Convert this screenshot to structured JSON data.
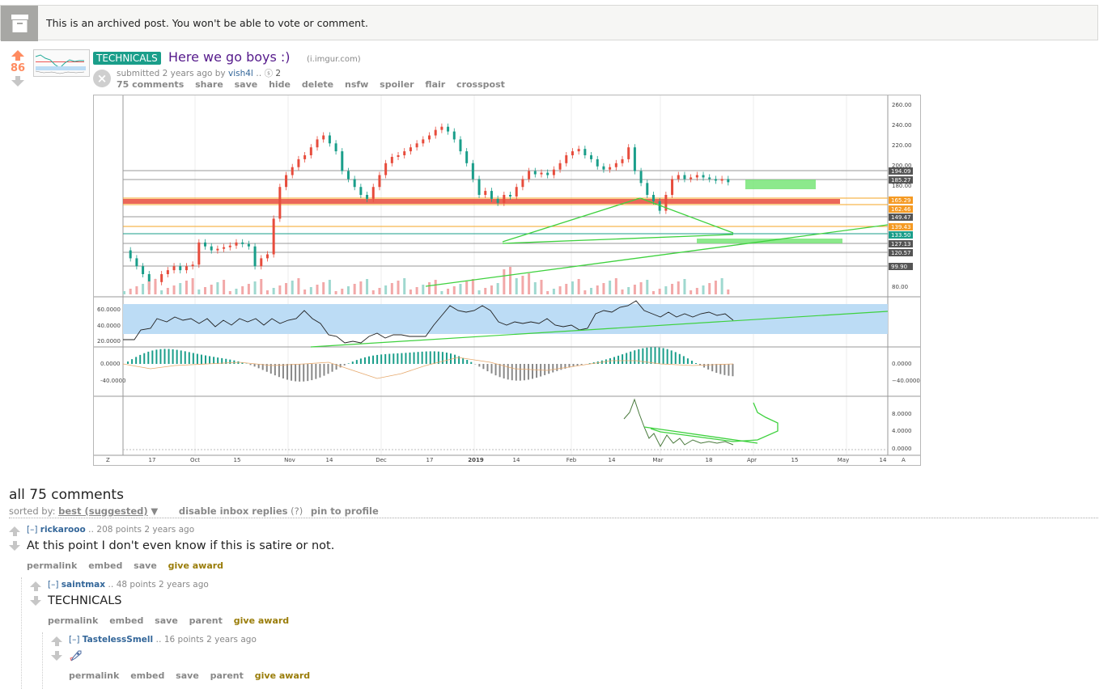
{
  "archived": {
    "message": "This is an archived post. You won't be able to vote or comment."
  },
  "post": {
    "score": "86",
    "flair": "TECHNICALS",
    "title": "Here we go boys :)",
    "domain": "(i.imgur.com)",
    "submitted": "submitted",
    "age": "2 years ago",
    "by": "by",
    "author": "vish4l",
    "award_count": "2",
    "buttons": [
      "75 comments",
      "share",
      "save",
      "hide",
      "delete",
      "nsfw",
      "spoiler",
      "flair",
      "crosspost"
    ]
  },
  "chart": {
    "price_labels": [
      "260.00",
      "240.00",
      "220.00",
      "200.00",
      "180.00",
      "80.00"
    ],
    "price_tags": [
      {
        "text": "194.09",
        "color": "#555555"
      },
      {
        "text": "185.27",
        "color": "#555555"
      },
      {
        "text": "165.29",
        "color": "#f59a23"
      },
      {
        "text": "162.46",
        "color": "#f59a23"
      },
      {
        "text": "149.47",
        "color": "#555555"
      },
      {
        "text": "139.43",
        "color": "#f59a23"
      },
      {
        "text": "133.50",
        "color": "#1a9e8a"
      },
      {
        "text": "127.13",
        "color": "#555555"
      },
      {
        "text": "120.57",
        "color": "#555555"
      },
      {
        "text": "99.90",
        "color": "#555555"
      }
    ],
    "rsi_labels": [
      "60.0000",
      "40.0000",
      "20.0000"
    ],
    "macd_left_labels": [
      "0.0000",
      "-40.0000"
    ],
    "macd_right_labels": [
      "0.0000",
      "−40.0000"
    ],
    "ind3_labels": [
      "8.0000",
      "4.0000",
      "0.0000"
    ],
    "x_ticks": [
      "17",
      "Oct",
      "15",
      "Nov",
      "14",
      "Dec",
      "17",
      "2019",
      "14",
      "Feb",
      "14",
      "Mar",
      "18",
      "Apr",
      "15",
      "May",
      "14"
    ],
    "corner_left": "Z",
    "corner_right": "A"
  },
  "comments_section": {
    "title": "all 75 comments",
    "sorted_by": "sorted by:",
    "sort_value": "best (suggested)",
    "disable_inbox": "disable inbox replies",
    "help": "(?)",
    "pin": "pin to profile"
  },
  "comments": [
    {
      "toggle": "[–]",
      "author": "rickarooo",
      "meta": "208 points 2 years ago",
      "body": "At this point I don't even know if this is satire or not.",
      "buttons": [
        "permalink",
        "embed",
        "save"
      ],
      "award": "give award"
    },
    {
      "toggle": "[–]",
      "author": "saintmax",
      "meta": "48 points 2 years ago",
      "body": "TECHNICALS",
      "buttons": [
        "permalink",
        "embed",
        "save",
        "parent"
      ],
      "award": "give award"
    },
    {
      "toggle": "[–]",
      "author": "TastelessSmell",
      "meta": "16 points 2 years ago",
      "body": "rocket-icon",
      "buttons": [
        "permalink",
        "embed",
        "save",
        "parent"
      ],
      "award": "give award"
    }
  ]
}
